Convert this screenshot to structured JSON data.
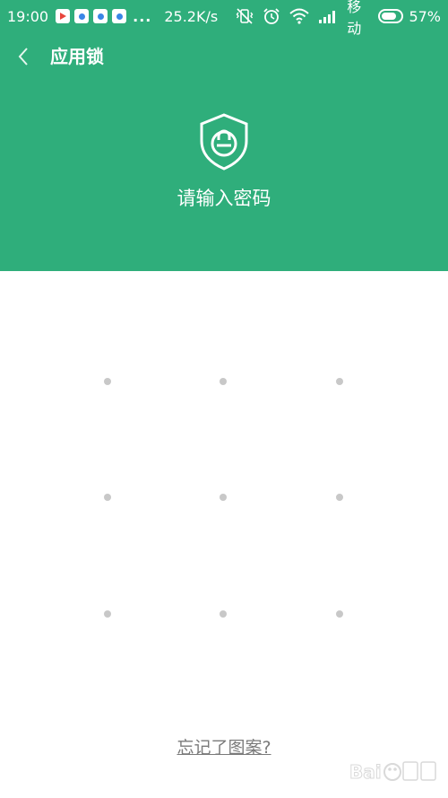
{
  "status_bar": {
    "time": "19:00",
    "overflow": "...",
    "net_speed": "25.2K/s",
    "carrier": "移动",
    "battery_percent": "57%",
    "battery_level": 0.57,
    "icons": [
      "play-store-icon",
      "app-notification-icon",
      "app-notification-icon",
      "app-notification-icon",
      "vibrate-off-icon",
      "alarm-icon",
      "wifi-icon",
      "signal-icon",
      "battery-icon"
    ]
  },
  "header": {
    "title": "应用锁",
    "prompt": "请输入密码",
    "back_icon": "chevron-left-icon",
    "lock_icon": "shield-lock-icon"
  },
  "pattern": {
    "rows": 3,
    "cols": 3
  },
  "footer": {
    "forgot_link": "忘记了图案?"
  },
  "colors": {
    "header_bg": "#2fae7b",
    "dot": "#c8c8c8",
    "link": "#7a7a7a"
  }
}
